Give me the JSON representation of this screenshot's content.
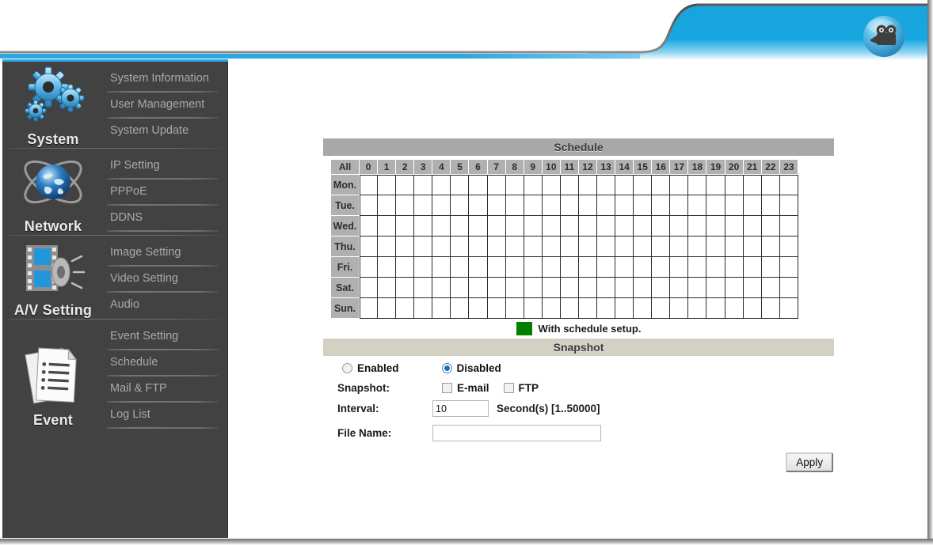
{
  "header": {
    "logo_icon": "video-camera-icon",
    "accent_color": "#17a7e0",
    "band_color": "#2aa8e0"
  },
  "sidebar": {
    "groups": [
      {
        "title": "System",
        "icon": "gears-icon",
        "items": [
          {
            "label": "System Information"
          },
          {
            "label": "User Management"
          },
          {
            "label": "System Update"
          }
        ]
      },
      {
        "title": "Network",
        "icon": "globe-icon",
        "items": [
          {
            "label": "IP Setting"
          },
          {
            "label": "PPPoE"
          },
          {
            "label": "DDNS"
          }
        ]
      },
      {
        "title": "A/V Setting",
        "icon": "film-speaker-icon",
        "items": [
          {
            "label": "Image Setting"
          },
          {
            "label": "Video Setting"
          },
          {
            "label": "Audio"
          }
        ]
      },
      {
        "title": "Event",
        "icon": "documents-icon",
        "items": [
          {
            "label": "Event Setting"
          },
          {
            "label": "Schedule"
          },
          {
            "label": "Mail & FTP"
          },
          {
            "label": "Log List"
          }
        ]
      }
    ]
  },
  "schedule": {
    "title": "Schedule",
    "all_label": "All",
    "hours": [
      "0",
      "1",
      "2",
      "3",
      "4",
      "5",
      "6",
      "7",
      "8",
      "9",
      "10",
      "11",
      "12",
      "13",
      "14",
      "15",
      "16",
      "17",
      "18",
      "19",
      "20",
      "21",
      "22",
      "23"
    ],
    "days": [
      "Mon.",
      "Tue.",
      "Wed.",
      "Thu.",
      "Fri.",
      "Sat.",
      "Sun."
    ],
    "selected_cells": [],
    "legend": {
      "color": "#008000",
      "text": "With schedule setup."
    }
  },
  "snapshot": {
    "title": "Snapshot",
    "state": {
      "enabled_label": "Enabled",
      "disabled_label": "Disabled",
      "selected": "Disabled"
    },
    "snapshot_row_label": "Snapshot:",
    "targets": [
      {
        "label": "E-mail",
        "checked": false
      },
      {
        "label": "FTP",
        "checked": false
      }
    ],
    "interval": {
      "label": "Interval:",
      "value": "10",
      "unit_note": "Second(s) [1..50000]"
    },
    "file_name": {
      "label": "File Name:",
      "value": "",
      "placeholder": ""
    }
  },
  "actions": {
    "apply_label": "Apply"
  }
}
